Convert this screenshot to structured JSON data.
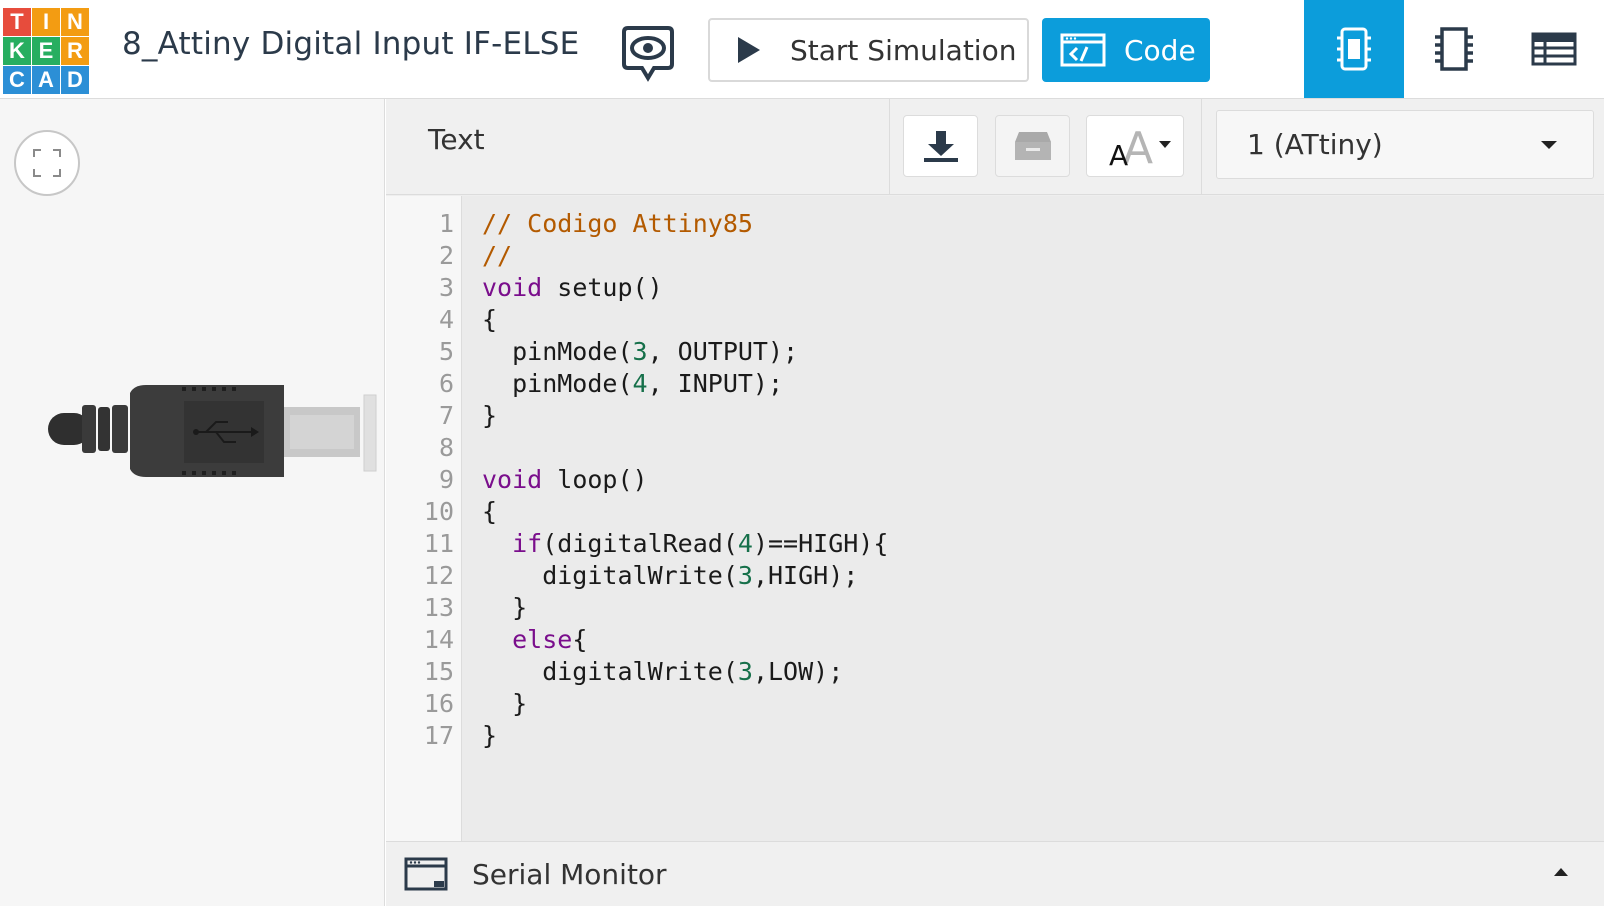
{
  "app": {
    "logo_letters": [
      "T",
      "I",
      "N",
      "K",
      "E",
      "R",
      "C",
      "A",
      "D"
    ],
    "logo_colors": [
      "#e74c3c",
      "#f39c12",
      "#f39c12",
      "#27ae60",
      "#27ae60",
      "#f39c12",
      "#2c8fd6",
      "#2c8fd6",
      "#2c8fd6"
    ],
    "project_title": "8_Attiny Digital Input IF-ELSE",
    "accent_color": "#0c9ddb"
  },
  "toolbar": {
    "start_simulation_label": "Start Simulation",
    "code_label": "Code",
    "view_tabs": [
      "circuit-view-icon",
      "components-icon",
      "bom-list-icon"
    ]
  },
  "code_panel": {
    "mode_label": "Text",
    "buttons": [
      "download-icon",
      "library-icon",
      "font-size-icon"
    ],
    "device_selected": "1 (ATtiny)"
  },
  "code": {
    "line_numbers": [
      "1",
      "2",
      "3",
      "4",
      "5",
      "6",
      "7",
      "8",
      "9",
      "10",
      "11",
      "12",
      "13",
      "14",
      "15",
      "16",
      "17"
    ],
    "lines": [
      "// Codigo Attiny85",
      "//",
      "void setup()",
      "{",
      "  pinMode(3, OUTPUT);",
      "  pinMode(4, INPUT);",
      "}",
      "",
      "void loop()",
      "{",
      "  if(digitalRead(4)==HIGH){",
      "    digitalWrite(3,HIGH);",
      "  }",
      "  else{",
      "    digitalWrite(3,LOW);",
      "  }",
      "}"
    ]
  },
  "serial_monitor": {
    "label": "Serial Monitor"
  }
}
